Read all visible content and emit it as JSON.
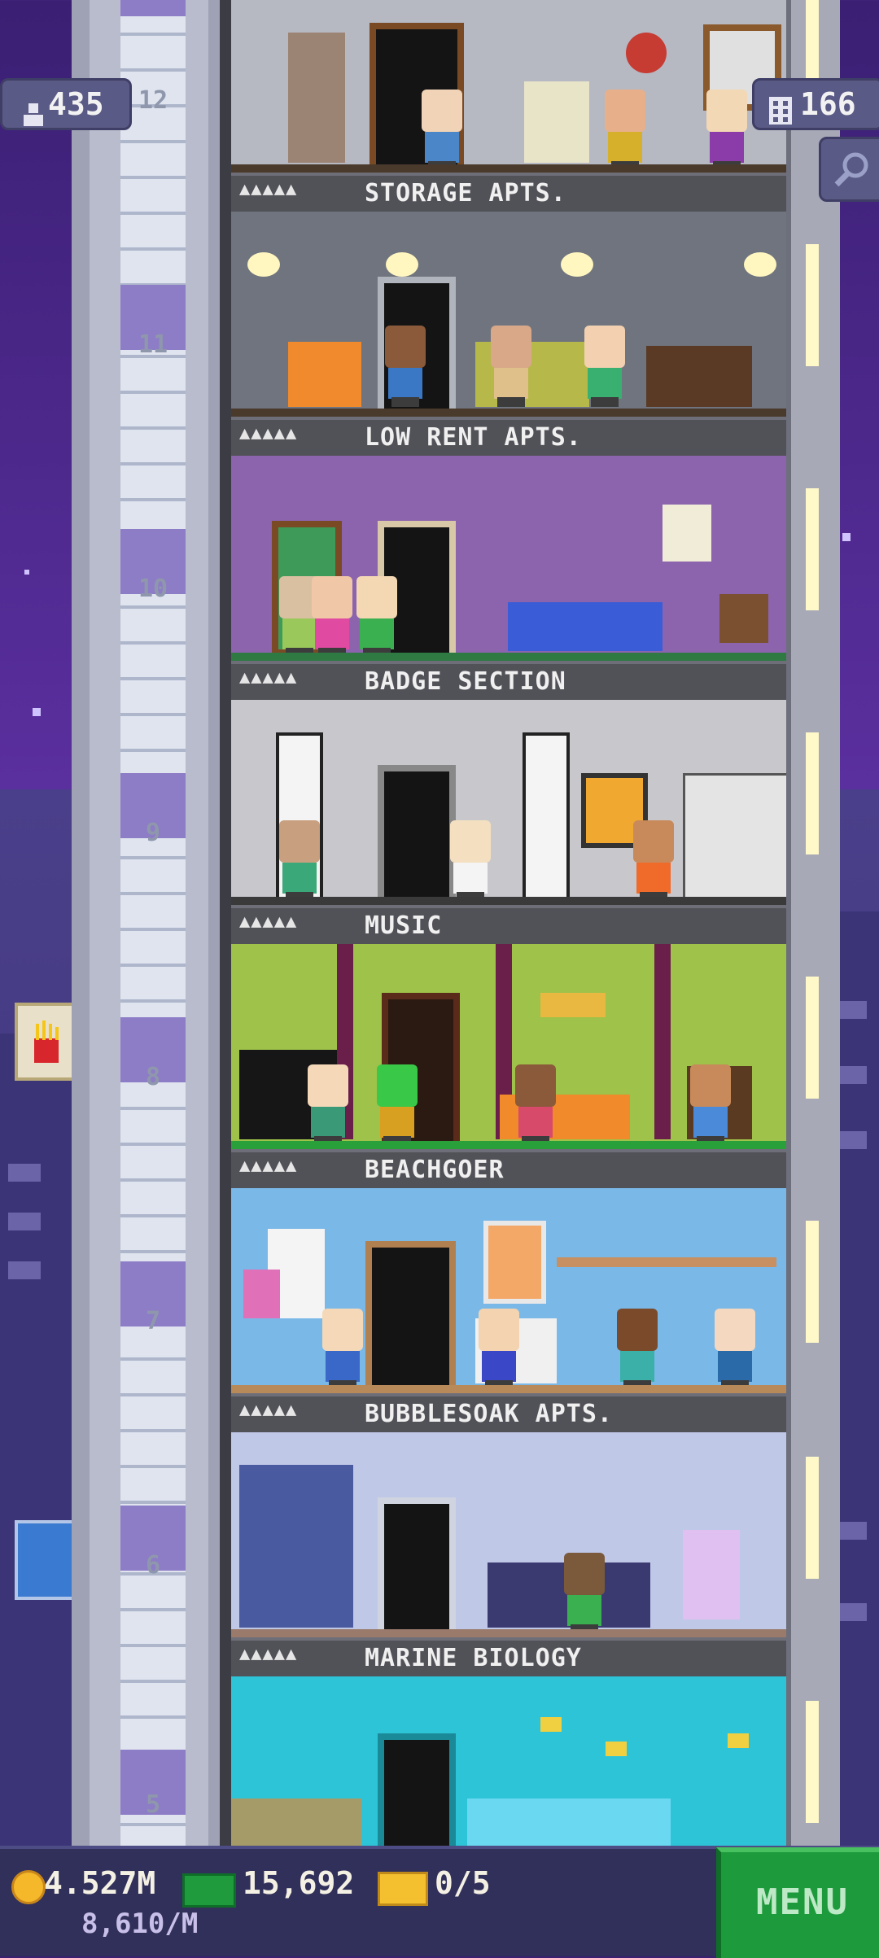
{
  "hud": {
    "population": "435",
    "stories": "166",
    "population_icon": "person-icon",
    "stories_icon": "building-icon",
    "search_icon": "magnifier-icon"
  },
  "floors": [
    {
      "number": "12",
      "name": "STORAGE APTS.",
      "stars": "▲▲▲▲▲"
    },
    {
      "number": "11",
      "name": "LOW RENT APTS.",
      "stars": "▲▲▲▲▲"
    },
    {
      "number": "10",
      "name": "BADGE SECTION",
      "stars": "▲▲▲▲▲"
    },
    {
      "number": "9",
      "name": "MUSIC",
      "stars": "▲▲▲▲▲"
    },
    {
      "number": "8",
      "name": "BEACHGOER",
      "stars": "▲▲▲▲▲"
    },
    {
      "number": "7",
      "name": "BUBBLESOAK APTS.",
      "stars": "▲▲▲▲▲"
    },
    {
      "number": "6",
      "name": "MARINE BIOLOGY",
      "stars": "▲▲▲▲▲"
    },
    {
      "number": "5",
      "name": "",
      "stars": ""
    }
  ],
  "bottom": {
    "coins": "4.527M",
    "coins_rate": "8,610/M",
    "bux": "15,692",
    "tickets": "0/5",
    "menu_label": "MENU"
  },
  "colors": {
    "menu_green": "#1d9a3c",
    "sky_purple": "#5a2f9e",
    "banner_gray": "#515158"
  }
}
